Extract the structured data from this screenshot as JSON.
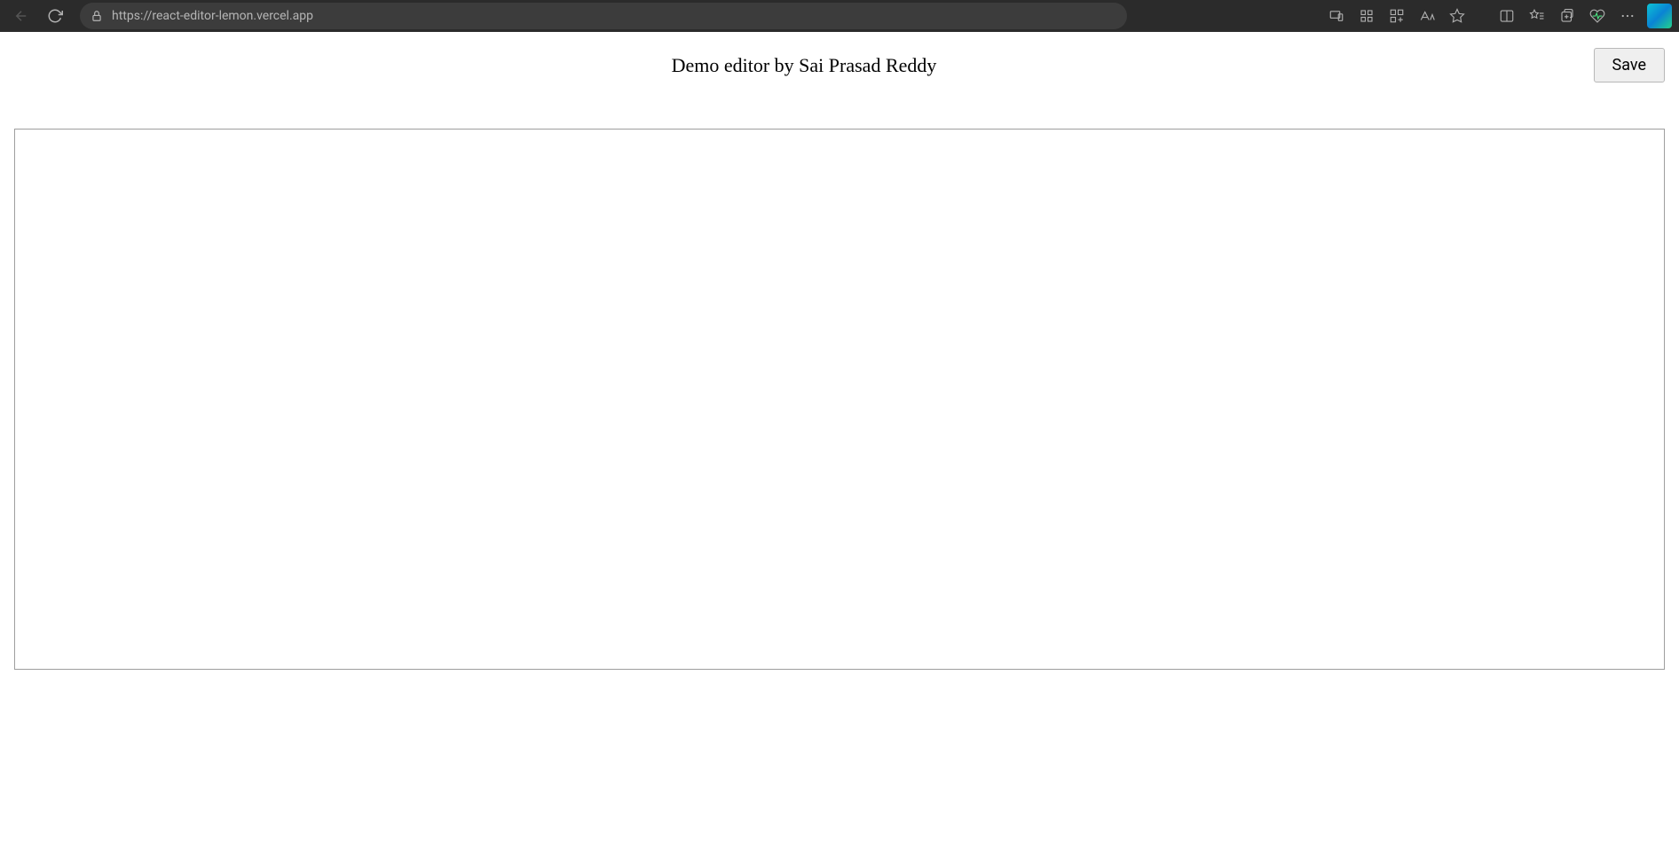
{
  "browser": {
    "url": "https://react-editor-lemon.vercel.app"
  },
  "header": {
    "title": "Demo editor by Sai Prasad Reddy",
    "save_label": "Save"
  },
  "editor": {
    "content": ""
  }
}
